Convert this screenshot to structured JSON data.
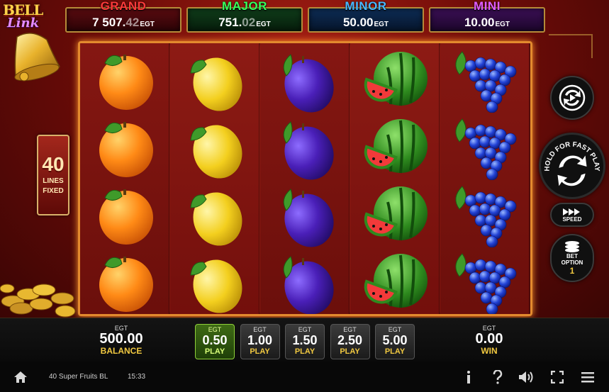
{
  "logo": {
    "line1": "BELL",
    "line2": "Link"
  },
  "jackpots": [
    {
      "name": "GRAND",
      "value": "7 507.",
      "value_partial": "42",
      "currency": "EGT"
    },
    {
      "name": "MAJOR",
      "value": "751.",
      "value_partial": "02",
      "currency": "EGT"
    },
    {
      "name": "MINOR",
      "value": "50.00",
      "value_partial": "",
      "currency": "EGT"
    },
    {
      "name": "MINI",
      "value": "10.00",
      "value_partial": "",
      "currency": "EGT"
    }
  ],
  "lines": {
    "count": "40",
    "label1": "LINES",
    "label2": "FIXED"
  },
  "reels": [
    {
      "symbol": "orange-icon",
      "rows": [
        "orange",
        "orange",
        "orange",
        "orange"
      ]
    },
    {
      "symbol": "lemon-icon",
      "rows": [
        "lemon",
        "lemon",
        "lemon",
        "lemon"
      ]
    },
    {
      "symbol": "plum-icon",
      "rows": [
        "plum",
        "plum",
        "plum",
        "plum"
      ]
    },
    {
      "symbol": "watermelon-icon",
      "rows": [
        "watermelon",
        "watermelon",
        "watermelon",
        "watermelon"
      ]
    },
    {
      "symbol": "grapes-icon",
      "rows": [
        "grapes",
        "grapes",
        "grapes",
        "grapes"
      ]
    }
  ],
  "controls": {
    "autoplay_icon": "autoplay-icon",
    "spin_label": "HOLD FOR FAST PLAY",
    "speed_label": "SPEED",
    "bet_option_label1": "BET",
    "bet_option_label2": "OPTION",
    "bet_option_value": "1"
  },
  "balance": {
    "currency": "EGT",
    "value": "500.00",
    "label": "BALANCE"
  },
  "win": {
    "currency": "EGT",
    "value": "0.00",
    "label": "WIN"
  },
  "bets": [
    {
      "currency": "EGT",
      "value": "0.50",
      "label": "PLAY",
      "active": true
    },
    {
      "currency": "EGT",
      "value": "1.00",
      "label": "PLAY",
      "active": false
    },
    {
      "currency": "EGT",
      "value": "1.50",
      "label": "PLAY",
      "active": false
    },
    {
      "currency": "EGT",
      "value": "2.50",
      "label": "PLAY",
      "active": false
    },
    {
      "currency": "EGT",
      "value": "5.00",
      "label": "PLAY",
      "active": false
    }
  ],
  "status": {
    "game_name": "40 Super Fruits BL",
    "time": "15:33",
    "icons": [
      "home-icon",
      "info-icon",
      "help-icon",
      "sound-icon",
      "fullscreen-icon",
      "menu-icon"
    ]
  },
  "colors": {
    "grand": "#ff3a3a",
    "major": "#38ff5c",
    "minor": "#4ab8ff",
    "mini": "#e05cff",
    "gold": "#f0c840",
    "reel_frame": "#e38a2e",
    "active_bet": "#3f6b15"
  }
}
